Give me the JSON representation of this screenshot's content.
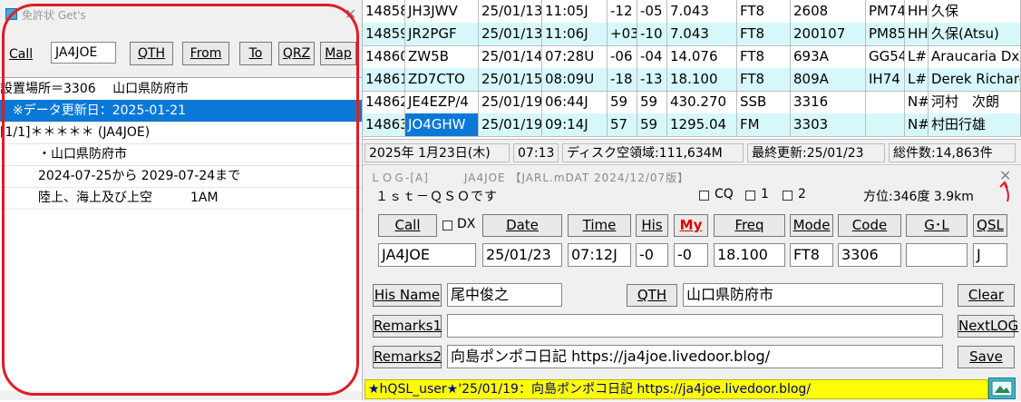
{
  "license_window": {
    "title": "免許状 Get's",
    "call_label": "Call",
    "call_value": "JA4JOE",
    "buttons": [
      "QTH",
      "From",
      "To",
      "QRZ",
      "Map"
    ],
    "rows": [
      "設置場所＝3306　 山口県防府市",
      "　※データ更新日：2025-01-21",
      "[1/1]＊＊＊＊＊ (JA4JOE)",
      "　　　・山口県防府市",
      "　　　2024-07-25から 2029-07-24まで",
      "　　　陸上、海上及び上空　　　1AM"
    ],
    "selected_row": 1
  },
  "log_table": {
    "rows": [
      [
        "14858",
        "JH3JWV",
        "25/01/13",
        "11:05J",
        "-12",
        "-05",
        "7.043",
        "FT8",
        "2608",
        "PM74",
        "HHH",
        "久保"
      ],
      [
        "14859",
        "JR2PGF",
        "25/01/13",
        "11:06J",
        "+03",
        "-10",
        "7.043",
        "FT8",
        "200107",
        "PM85L",
        "HHH",
        "久保(Atsu)"
      ],
      [
        "14860",
        "ZW5B",
        "25/01/14",
        "07:28U",
        "-06",
        "-04",
        "14.076",
        "FT8",
        "693A",
        "GG54",
        "L#",
        "Araucaria Dx Group"
      ],
      [
        "14861",
        "ZD7CTO",
        "25/01/15",
        "08:09U",
        "-18",
        "-13",
        "18.100",
        "FT8",
        "809A",
        "IH74",
        "L#",
        "Derek Richards"
      ],
      [
        "14862",
        "JE4EZP/4",
        "25/01/19",
        "06:44J",
        "59",
        "59",
        "430.270",
        "SSB",
        "3316",
        "",
        "N#",
        "河村　次朗"
      ],
      [
        "14863",
        "JO4GHW",
        "25/01/19",
        "09:14J",
        "57",
        "59",
        "1295.04",
        "FM",
        "3303",
        "",
        "N#",
        "村田行雄"
      ]
    ]
  },
  "status_bar": {
    "date": "2025年 1月23日(木)",
    "time": "07:13",
    "disk": "ディスク空領域:111,634M",
    "updated": "最終更新:25/01/23",
    "total": "総件数:14,863件"
  },
  "log_form": {
    "window_title": "ＬＯＧ-[A]　　　JA4JOE 【JARL.mDAT 2024/12/07版】",
    "qso_label": "１ｓｔ－ＱＳＯです",
    "checkboxes": [
      "CQ",
      "1",
      "2"
    ],
    "bearing": "方位:346度 3.9km",
    "headers": {
      "call": "Call",
      "dx": "DX",
      "date": "Date",
      "time": "Time",
      "his": "His",
      "my": "My",
      "freq": "Freq",
      "mode": "Mode",
      "code": "Code",
      "gl": "G･L",
      "qsl": "QSL"
    },
    "values": {
      "call": "JA4JOE",
      "date": "25/01/23",
      "time": "07:12J",
      "his": "-0",
      "my": "-0",
      "freq": "18.100",
      "mode": "FT8",
      "code": "3306",
      "gl": "",
      "qsl": "J"
    },
    "his_name_label": "His Name",
    "his_name": "尾中俊之",
    "qth_label": "QTH",
    "qth": "山口県防府市",
    "clear_label": "Clear",
    "remarks1_label": "Remarks1",
    "remarks1": "",
    "nextlog_label": "NextLOG",
    "remarks2_label": "Remarks2",
    "remarks2": "向島ポンポコ日記 https://ja4joe.livedoor.blog/",
    "save_label": "Save",
    "ticker": "★hQSL_user★'25/01/19：向島ポンポコ日記 https://ja4joe.livedoor.blog/"
  },
  "colors": {
    "selection": "#0a78d7",
    "alt_row": "#d7f8fb",
    "annotation_red": "#e01c24",
    "ticker_bg": "#ffff00",
    "my_label": "#e00000"
  }
}
